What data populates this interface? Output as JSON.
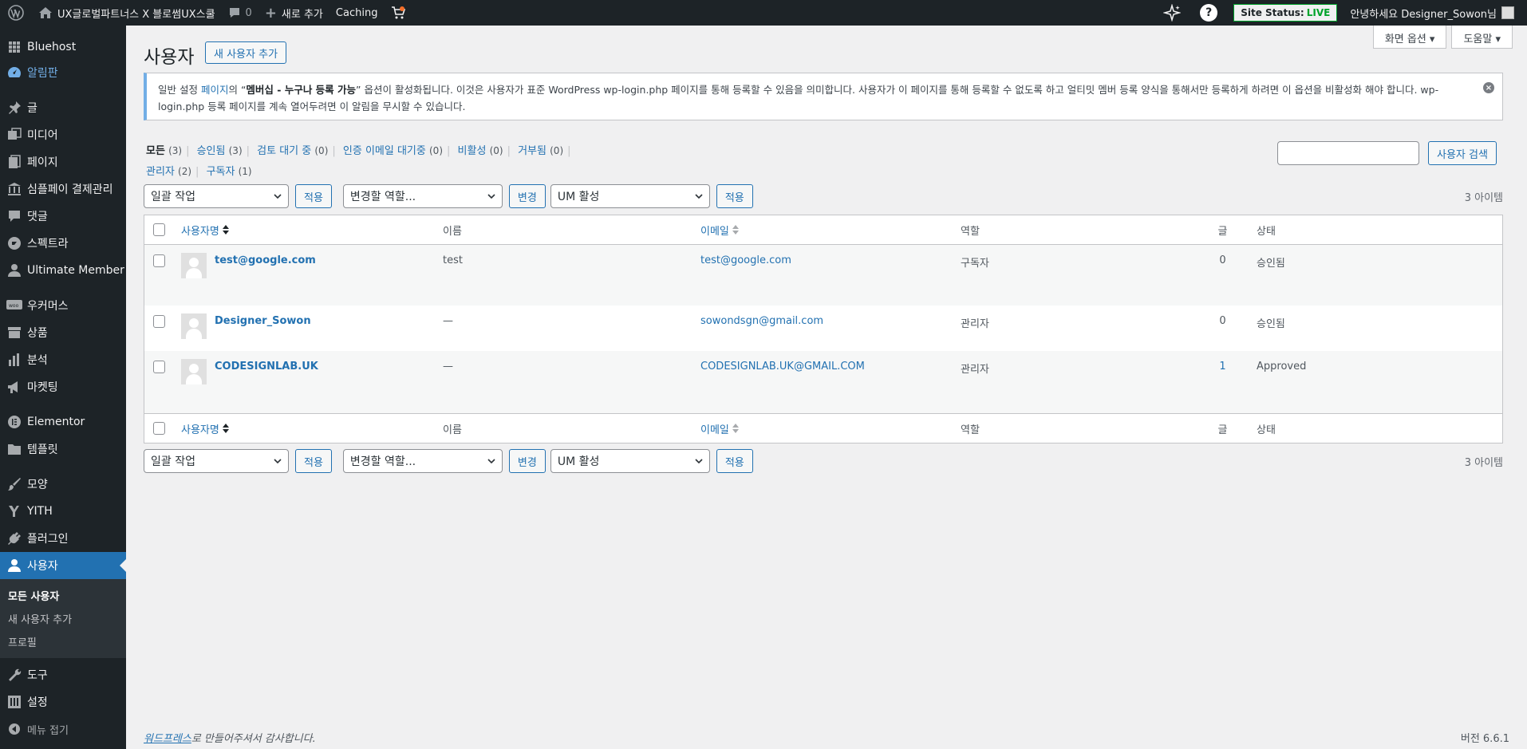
{
  "adminbar": {
    "site_name": "UX글로벌파트너스 X 블로썸UX스쿨",
    "comments_count": "0",
    "new_label": "새로 추가",
    "caching_label": "Caching",
    "site_status_label": "Site Status:",
    "site_status_value": "LIVE",
    "help_label": "?",
    "greeting": "안녕하세요 Designer_Sowon님"
  },
  "sidebar": {
    "items": [
      {
        "label": "Bluehost",
        "icon": "grid-icon"
      },
      {
        "label": "알림판",
        "icon": "dashboard-icon"
      },
      {
        "label": "글",
        "icon": "pin-icon"
      },
      {
        "label": "미디어",
        "icon": "media-icon"
      },
      {
        "label": "페이지",
        "icon": "page-icon"
      },
      {
        "label": "심플페이 결제관리",
        "icon": "bank-icon"
      },
      {
        "label": "댓글",
        "icon": "comment-icon"
      },
      {
        "label": "스펙트라",
        "icon": "spectra-icon"
      },
      {
        "label": "Ultimate Member",
        "icon": "user-icon"
      },
      {
        "label": "우커머스",
        "icon": "woo-icon"
      },
      {
        "label": "상품",
        "icon": "archive-icon"
      },
      {
        "label": "분석",
        "icon": "chart-icon"
      },
      {
        "label": "마켓팅",
        "icon": "megaphone-icon"
      },
      {
        "label": "Elementor",
        "icon": "elementor-icon"
      },
      {
        "label": "템플릿",
        "icon": "folder-icon"
      },
      {
        "label": "모양",
        "icon": "brush-icon"
      },
      {
        "label": "YITH",
        "icon": "yith-icon"
      },
      {
        "label": "플러그인",
        "icon": "plugin-icon"
      },
      {
        "label": "사용자",
        "icon": "user-icon"
      },
      {
        "label": "도구",
        "icon": "wrench-icon"
      },
      {
        "label": "설정",
        "icon": "settings-icon"
      },
      {
        "label": "메뉴 접기",
        "icon": "collapse-icon"
      }
    ],
    "submenu": [
      "모든 사용자",
      "새 사용자 추가",
      "프로필"
    ]
  },
  "screen_options": "화면 옵션 ▾",
  "help_tab": "도움말 ▾",
  "page_title": "사용자",
  "add_new_user": "새 사용자 추가",
  "notice": {
    "part1": "일반 설정 ",
    "link": "페이지",
    "part2": "의 “",
    "bold": "멤버십 - 누구나 등록 가능",
    "part3": "” 옵션이 활성화됩니다. 이것은 사용자가 표준 WordPress wp-login.php 페이지를 통해 등록할 수 있음을 의미합니다. 사용자가 이 페이지를 통해 등록할 수 없도록 하고 얼티밋 멤버 등록 양식을 통해서만 등록하게 하려면 이 옵션을 비활성화 해야 합니다. wp-login.php 등록 페이지를 계속 열어두려면 이 알림을 무시할 수 있습니다.",
    "dismiss": "×"
  },
  "filters": {
    "row1": [
      {
        "label": "모든",
        "count": "(3)"
      },
      {
        "label": "승인됨",
        "count": "(3)"
      },
      {
        "label": "검토 대기 중",
        "count": "(0)"
      },
      {
        "label": "인증 이메일 대기중",
        "count": "(0)"
      },
      {
        "label": "비활성",
        "count": "(0)"
      },
      {
        "label": "거부됨",
        "count": "(0)"
      }
    ],
    "row2": [
      {
        "label": "관리자",
        "count": "(2)"
      },
      {
        "label": "구독자",
        "count": "(1)"
      }
    ]
  },
  "search_button": "사용자 검색",
  "tablenav": {
    "bulk_action": "일괄 작업",
    "apply": "적용",
    "change_role": "변경할 역할...",
    "change": "변경",
    "um_action": "UM 활성",
    "apply2": "적용",
    "count": "3 아이템"
  },
  "table": {
    "headers": {
      "username": "사용자명",
      "name": "이름",
      "email": "이메일",
      "role": "역할",
      "posts": "글",
      "status": "상태"
    },
    "rows": [
      {
        "username": "test@google.com",
        "name": "test",
        "email": "test@google.com",
        "role": "구독자",
        "posts": "0",
        "status": "승인됨"
      },
      {
        "username": "Designer_Sowon",
        "name": "—",
        "email": "sowondsgn@gmail.com",
        "role": "관리자",
        "posts": "0",
        "status": "승인됨"
      },
      {
        "username": "CODESIGNLAB.UK",
        "name": "—",
        "email": "CODESIGNLAB.UK@GMAIL.COM",
        "role": "관리자",
        "posts": "1",
        "status": "Approved"
      }
    ]
  },
  "footer": {
    "link": "워드프레스",
    "text": "로 만들어주셔서 감사합니다.",
    "version": "버전 6.6.1"
  }
}
